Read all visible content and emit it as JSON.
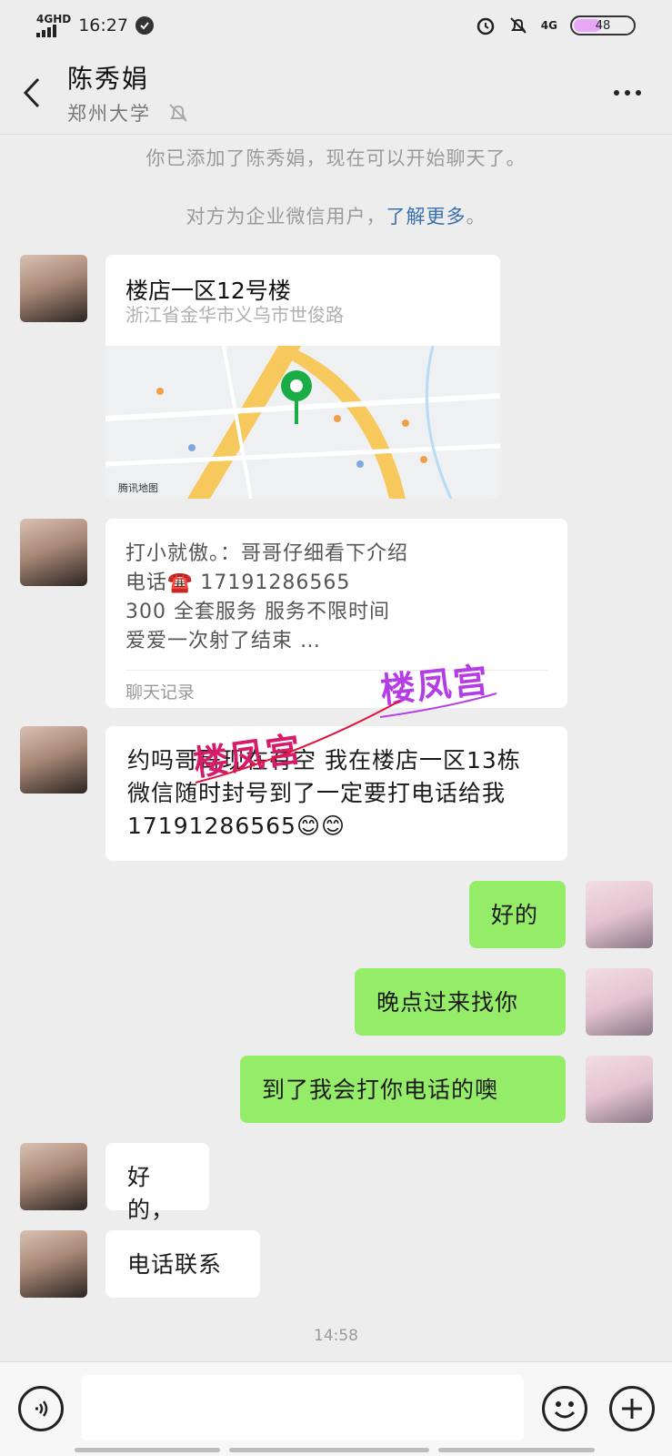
{
  "status_bar": {
    "network_left": "4GHD",
    "time": "16:27",
    "network_right": "4G",
    "battery": "48",
    "battery_level": 0.48
  },
  "header": {
    "contact_name": "陈秀娟",
    "contact_org": "郑州大学"
  },
  "notices": {
    "added": "你已添加了陈秀娟，现在可以开始聊天了。",
    "enterprise_prefix": "对方为企业微信用户，",
    "learn_more": "了解更多",
    "enterprise_suffix": "。"
  },
  "messages": {
    "location": {
      "title": "楼店一区12号楼",
      "address": "浙江省金华市义乌市世俊路",
      "map_provider": "腾讯地图"
    },
    "record": {
      "line1": "打小就傲。：哥哥仔细看下介绍",
      "line2_prefix": "电话☎️ ",
      "line2_number": "17191286565",
      "line3": "300 全套服务  服务不限时间",
      "line4": " 爱爱一次射了结束 …",
      "footer": "聊天记录"
    },
    "text1": "约吗哥哥现在有空  我在楼店一区13栋 微信随时封号到了一定要打电话给我17191286565😊😊",
    "out1": "好的",
    "out2": "晚点过来找你",
    "out3": "到了我会打你电话的噢",
    "in2": "好的，",
    "in3": "电话联系"
  },
  "watermarks": {
    "mark1": "楼凤宫",
    "mark2": "楼凤宫"
  },
  "timestamp": "14:58",
  "input": {
    "placeholder": ""
  }
}
